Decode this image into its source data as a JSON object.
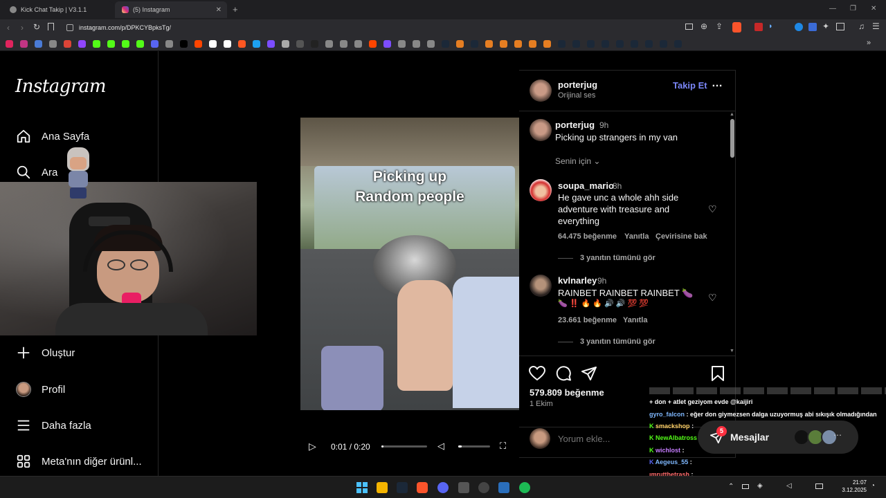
{
  "browser": {
    "tabs": [
      {
        "label": "Kick Chat Takip | V3.1.1"
      },
      {
        "label": "(5) Instagram"
      }
    ],
    "url": "instagram.com/p/DPKCYBpksTg/",
    "new_tab_glyph": "+",
    "bookmark_colors": [
      "#e0245e",
      "#c13584",
      "#4a7bd6",
      "#888",
      "#db4437",
      "#9146ff",
      "#53fc18",
      "#53fc18",
      "#53fc18",
      "#53fc18",
      "#5865f2",
      "#888",
      "#000",
      "#ff4500",
      "#fff",
      "#fff",
      "#ff5722",
      "#1da1f2",
      "#7c4dff",
      "#aaa",
      "#555",
      "#222",
      "#888",
      "#888",
      "#888",
      "#ff4500",
      "#7c4dff",
      "#888",
      "#888",
      "#888",
      "#1b2838",
      "#e67e22",
      "#1b2838",
      "#e67e22",
      "#e67e22",
      "#e67e22",
      "#e67e22",
      "#e67e22",
      "#1b2838",
      "#1b2838",
      "#1b2838",
      "#1b2838",
      "#1b2838",
      "#1b2838",
      "#1b2838",
      "#1b2838",
      "#1b2838"
    ]
  },
  "sidebar": {
    "logo": "Instagram",
    "items": [
      {
        "label": "Ana Sayfa",
        "icon": "home-icon",
        "glyph": "⌂"
      },
      {
        "label": "Ara",
        "icon": "search-icon",
        "glyph": "⚲"
      },
      {
        "label": "Oluştur",
        "icon": "plus-icon",
        "glyph": "+"
      },
      {
        "label": "Profil",
        "icon": "profile-avatar-icon",
        "glyph": ""
      },
      {
        "label": "Daha fazla",
        "icon": "menu-icon",
        "glyph": "☰"
      },
      {
        "label": "Meta'nın diğer ürünl...",
        "icon": "meta-grid-icon",
        "glyph": "⊞"
      }
    ]
  },
  "video": {
    "overlay_line1": "Picking up",
    "overlay_line2": "Random people",
    "time": "0:01 / 0:20",
    "progress": 0.05,
    "volume": 0.1
  },
  "post": {
    "author": "porterjug",
    "audio": "Orijinal ses",
    "follow_label": "Takip Et",
    "more_glyph": "…",
    "caption_user": "porterjug",
    "caption_time": "9h",
    "caption_text": "Picking up strangers in my van",
    "sort_label": "Senin için",
    "comments": [
      {
        "user": "soupa_mario",
        "time": "8h",
        "text_lines": [
          "He gave unc a whole ahh side",
          "adventure with treasure and",
          "everything"
        ],
        "likes": "64.475 beğenme",
        "reply": "Yanıtla",
        "translate": "Çevirisine bak",
        "replies": "3 yanıtın tümünü gör"
      },
      {
        "user": "kvlnarley",
        "time": "9h",
        "text_lines": [
          "RAINBET RAINBET RAINBET 🍆",
          "🍆 ‼️ 🔥 🔥 🔊 🔊 💯 💯"
        ],
        "likes": "23.661 beğenme",
        "reply": "Yanıtla",
        "replies": "3 yanıtın tümünü gör"
      }
    ],
    "like_count": "579.809 beğenme",
    "date": "1 Ekim",
    "comment_placeholder": "Yorum ekle..."
  },
  "chat": {
    "lines": [
      {
        "user": "",
        "text": "+ don + atlet geziyom evde @kaijiri",
        "color": "#ffffff"
      },
      {
        "user": "gyro_falcon",
        "text": ": eğer don giymezsen dalga uzuyormuş abi sıkışık olmadığından",
        "color": "#7fb8ff"
      },
      {
        "user": "smackshop",
        "text": ":",
        "color": "#ffd166"
      },
      {
        "user": "NewAlbatross",
        "text": ":",
        "color": "#53fc18"
      },
      {
        "user": "wichlost",
        "text": ":",
        "color": "#c77dff"
      },
      {
        "user": "Aegeus_55",
        "text": ":",
        "color": "#7fb8ff"
      },
      {
        "user": "ımrutthetrash",
        "text": ":",
        "color": "#ff6b6b"
      }
    ]
  },
  "messages_pill": {
    "label": "Mesajlar",
    "badge": "5"
  },
  "taskbar": {
    "time": "21:07",
    "date": "3.12.2025",
    "icon_colors": [
      "#0078d4",
      "#f4b400",
      "#1b2838",
      "#fb542b",
      "#5865f2",
      "#444",
      "#444",
      "#2a6ebb",
      "#1db954"
    ]
  },
  "colors": {
    "follow": "#4a5df9",
    "background": "#000000",
    "border": "#262626",
    "muted": "#a8a8a8"
  }
}
